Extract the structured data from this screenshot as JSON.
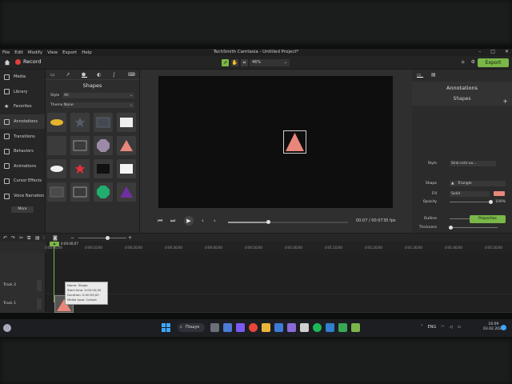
{
  "window": {
    "title": "TechSmith Camtasia - Untitled Project*"
  },
  "menu": [
    "File",
    "Edit",
    "Modify",
    "View",
    "Export",
    "Help"
  ],
  "toolbar": {
    "record_label": "Record",
    "zoom_value": "46%",
    "export_label": "Export"
  },
  "sidebar": {
    "items": [
      {
        "label": "Media"
      },
      {
        "label": "Library"
      },
      {
        "label": "Favorites"
      },
      {
        "label": "Annotations"
      },
      {
        "label": "Transitions"
      },
      {
        "label": "Behaviors"
      },
      {
        "label": "Animations"
      },
      {
        "label": "Cursor Effects"
      },
      {
        "label": "Voice Narration"
      }
    ],
    "more_label": "More"
  },
  "library": {
    "title": "Shapes",
    "style_label": "Style",
    "style_value": "All",
    "theme_label": "Theme",
    "theme_value": "None"
  },
  "playback": {
    "timecode": "00:07 / 00:07",
    "fps": "30 fps",
    "progress": 0.33
  },
  "properties": {
    "title": "Annotations",
    "subtitle": "Shapes",
    "style_label": "Style",
    "style_value": "Sink-ccts-uv...",
    "shape_label": "Shape",
    "shape_value": "Triangle",
    "fill_label": "Fill",
    "fill_value": "Solid",
    "fill_color": "#e8877a",
    "opacity_label": "Opacity",
    "opacity_value": "100%",
    "outline_label": "Outline",
    "thickness_label": "Thickness",
    "outline_opacity_label": "Opacity",
    "outline_opacity_value": "100%",
    "button_label": "Properties"
  },
  "timeline": {
    "playhead_tc": "0:00:00;07",
    "ticks": [
      "0:00:00;00",
      "0:00:10;00",
      "0:00:20;00",
      "0:00:30;00",
      "0:00:40;00",
      "0:00:50;00",
      "0:01:00;00",
      "0:01:10;00",
      "0:01:20;00",
      "0:01:30;00",
      "0:01:40;00",
      "0:01:50;00"
    ],
    "tracks": [
      "Track 2",
      "Track 1"
    ],
    "tooltip": {
      "name": "Name: Shape",
      "start": "Start time: 0:00:00;00",
      "duration": "Duration: 0:00:05;00",
      "media_type": "Media type: Callout"
    }
  },
  "taskbar": {
    "search_label": "Пошук",
    "language": "ENG",
    "time": "16:09",
    "date": "03.02.2023"
  },
  "colors": {
    "accent": "#7ab648",
    "shape": "#e8877a",
    "record": "#e3403a"
  }
}
